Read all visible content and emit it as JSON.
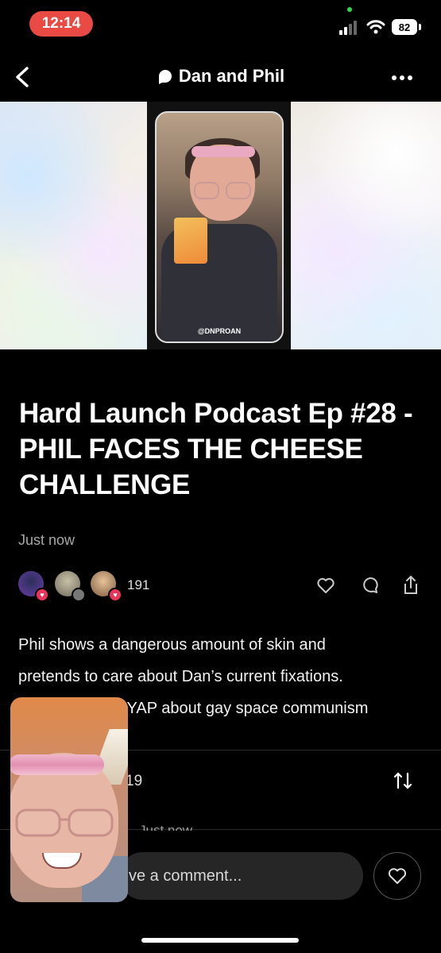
{
  "status_bar": {
    "time": "12:14",
    "battery": "82"
  },
  "header": {
    "title": "Dan and Phil"
  },
  "hero": {
    "handle": "@DNPROAN"
  },
  "post": {
    "title": "Hard Launch Podcast Ep #28 - PHIL FACES THE CHEESE CHALLENGE",
    "timestamp": "Just now",
    "like_count": "191",
    "body_line1": "Phil shows a dangerous amount of skin and",
    "body_line2": "pretends to care about Dan’s current fixations.",
    "body_line3": "S YAP about gay space communism"
  },
  "comments": {
    "count": "19",
    "reply_stub": "Just now"
  },
  "composer": {
    "placeholder": "ve a comment..."
  },
  "colors": {
    "time_pill": "#e94a43",
    "heart_badge": "#e8355a"
  }
}
